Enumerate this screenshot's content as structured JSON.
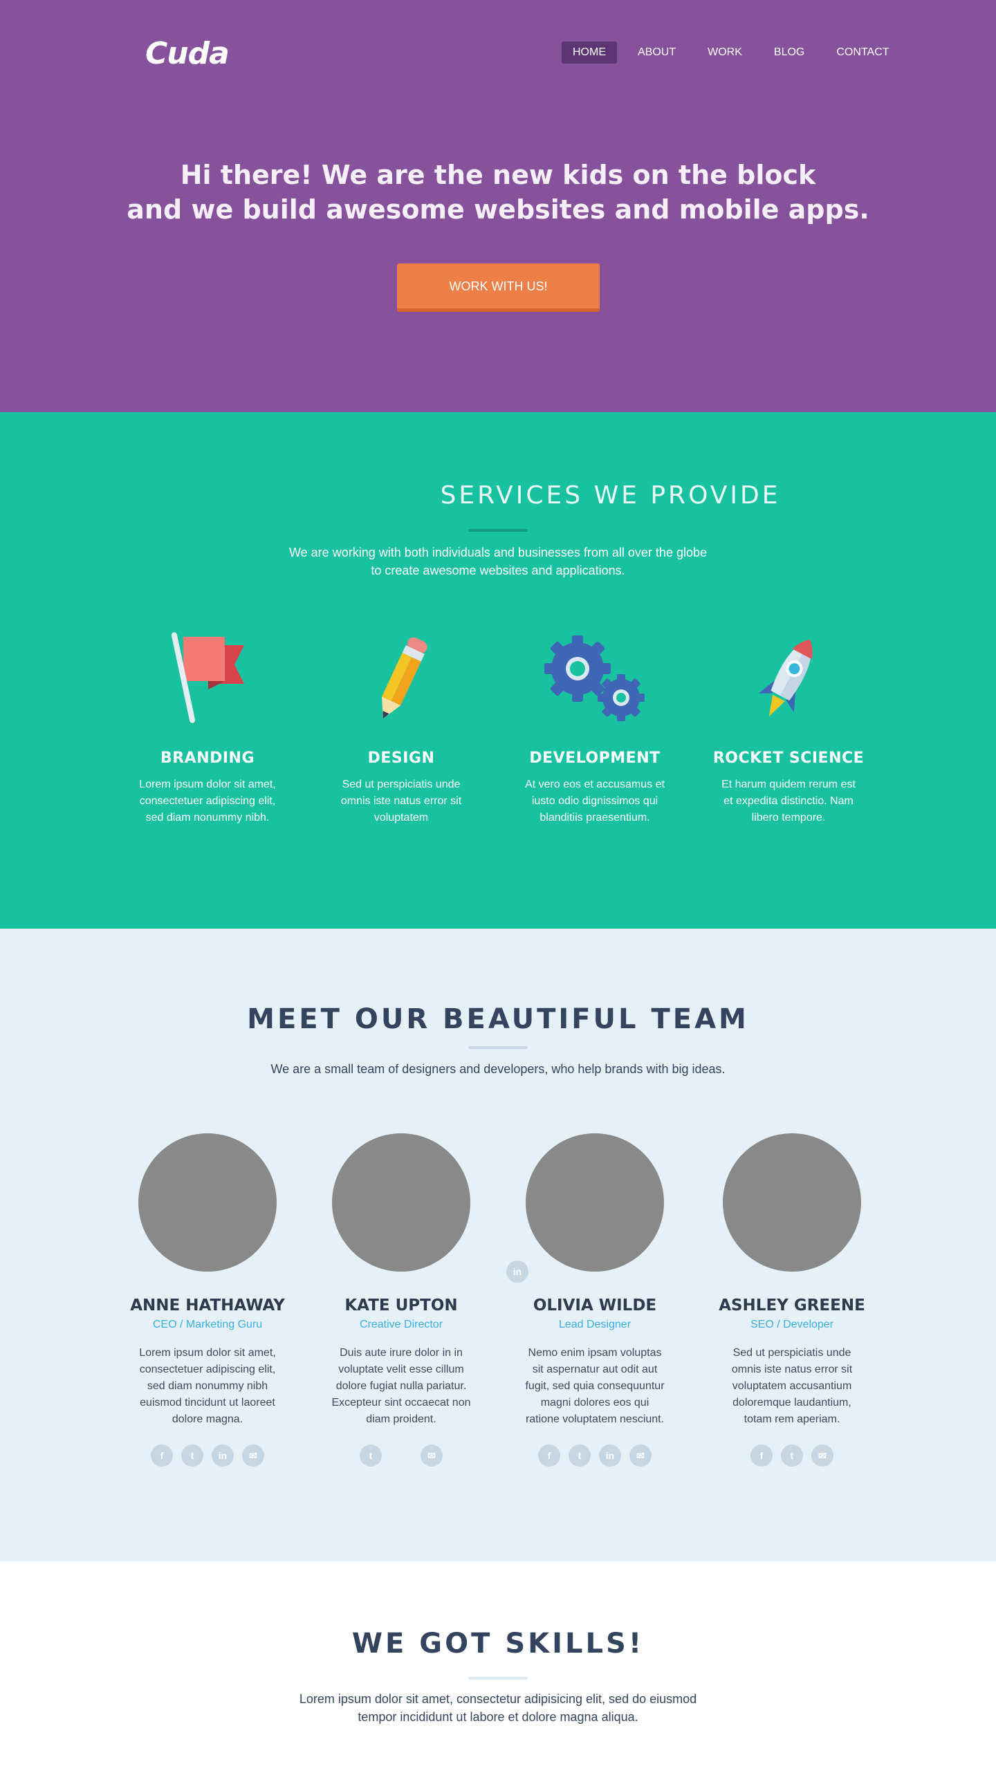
{
  "brand": {
    "logo": "Cuda"
  },
  "nav": {
    "items": [
      {
        "label": "HOME",
        "active": true
      },
      {
        "label": "ABOUT",
        "active": false
      },
      {
        "label": "WORK",
        "active": false
      },
      {
        "label": "BLOG",
        "active": false
      },
      {
        "label": "CONTACT",
        "active": false
      }
    ]
  },
  "hero": {
    "line1": "Hi there! We are the new kids on the block",
    "line2": "and we build awesome websites and mobile apps.",
    "cta": "WORK WITH US!"
  },
  "services": {
    "heading": "SERVICES WE PROVIDE",
    "intro_line1": "We are working with both individuals and businesses from all over the globe",
    "intro_line2": "to create awesome websites and applications.",
    "items": [
      {
        "name": "BRANDING",
        "icon": "flag-icon",
        "desc": "Lorem ipsum dolor sit amet, consectetuer adipiscing elit, sed diam nonummy nibh."
      },
      {
        "name": "DESIGN",
        "icon": "pencil-icon",
        "desc": "Sed ut perspiciatis unde omnis iste natus error sit voluptatem"
      },
      {
        "name": "DEVELOPMENT",
        "icon": "gears-icon",
        "desc": "At vero eos et accusamus et iusto odio dignissimos qui blanditiis praesentium."
      },
      {
        "name": "ROCKET SCIENCE",
        "icon": "rocket-icon",
        "desc": "Et harum quidem rerum est et expedita distinctio. Nam libero tempore."
      }
    ]
  },
  "team": {
    "heading": "MEET OUR BEAUTIFUL TEAM",
    "intro": "We are a small team of designers and developers, who help brands with big ideas.",
    "members": [
      {
        "name": "ANNE HATHAWAY",
        "role": "CEO / Marketing Guru",
        "bio": "Lorem ipsum dolor sit amet, consectetuer adipiscing elit, sed diam nonummy nibh euismod tincidunt ut laoreet dolore magna."
      },
      {
        "name": "KATE UPTON",
        "role": "Creative Director",
        "bio": "Duis aute irure dolor in in voluptate velit esse cillum dolore fugiat nulla pariatur. Excepteur sint occaecat non diam proident."
      },
      {
        "name": "OLIVIA WILDE",
        "role": "Lead Designer",
        "bio": "Nemo enim ipsam voluptas sit aspernatur aut odit aut fugit, sed quia consequuntur magni dolores eos qui ratione voluptatem nesciunt."
      },
      {
        "name": "ASHLEY GREENE",
        "role": "SEO / Developer",
        "bio": "Sed ut perspiciatis unde omnis iste natus error sit voluptatem accusantium doloremque laudantium, totam rem aperiam."
      }
    ],
    "social_glyphs": {
      "facebook": "f",
      "twitter": "t",
      "linkedin": "in",
      "mail": "✉"
    }
  },
  "skills": {
    "heading": "WE GOT SKILLS!",
    "intro_line1": "Lorem ipsum dolor sit amet, consectetur adipisicing elit, sed do eiusmod",
    "intro_line2": "tempor incididunt ut labore et dolore magna aliqua."
  },
  "colors": {
    "hero_bg": "#86529c",
    "services_bg": "#18c2a0",
    "team_bg": "#e6f0f7",
    "cta": "#ee7f49",
    "role_accent": "#3aaee0"
  }
}
